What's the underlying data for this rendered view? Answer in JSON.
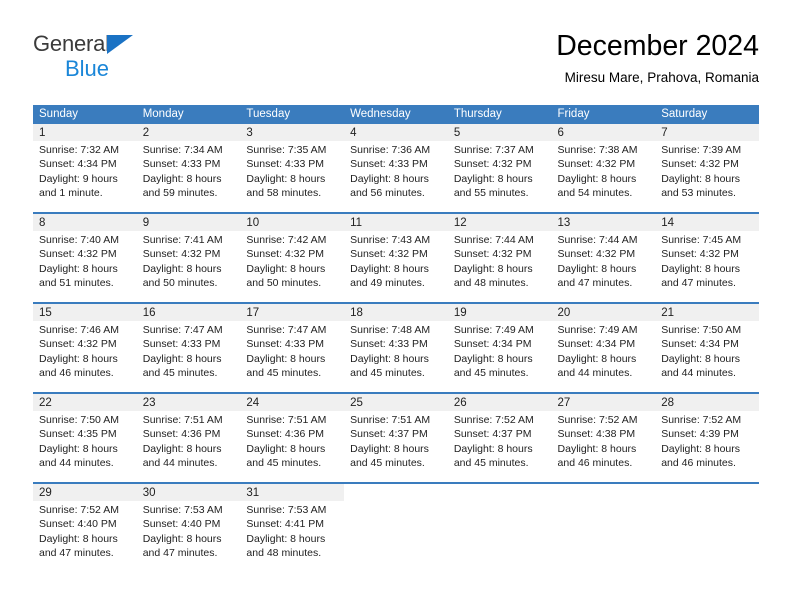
{
  "brand": {
    "line1": "General",
    "line2": "Blue",
    "triangle_color": "#1a72c4",
    "line2_color": "#1a86d8"
  },
  "header": {
    "month_title": "December 2024",
    "location": "Miresu Mare, Prahova, Romania"
  },
  "theme": {
    "header_bg": "#3a7cbe",
    "daynum_bg": "#f0f0f0",
    "text": "#222222"
  },
  "weekdays": [
    "Sunday",
    "Monday",
    "Tuesday",
    "Wednesday",
    "Thursday",
    "Friday",
    "Saturday"
  ],
  "weeks": [
    [
      {
        "day": "1",
        "sunrise": "Sunrise: 7:32 AM",
        "sunset": "Sunset: 4:34 PM",
        "daylight_1": "Daylight: 9 hours",
        "daylight_2": "and 1 minute."
      },
      {
        "day": "2",
        "sunrise": "Sunrise: 7:34 AM",
        "sunset": "Sunset: 4:33 PM",
        "daylight_1": "Daylight: 8 hours",
        "daylight_2": "and 59 minutes."
      },
      {
        "day": "3",
        "sunrise": "Sunrise: 7:35 AM",
        "sunset": "Sunset: 4:33 PM",
        "daylight_1": "Daylight: 8 hours",
        "daylight_2": "and 58 minutes."
      },
      {
        "day": "4",
        "sunrise": "Sunrise: 7:36 AM",
        "sunset": "Sunset: 4:33 PM",
        "daylight_1": "Daylight: 8 hours",
        "daylight_2": "and 56 minutes."
      },
      {
        "day": "5",
        "sunrise": "Sunrise: 7:37 AM",
        "sunset": "Sunset: 4:32 PM",
        "daylight_1": "Daylight: 8 hours",
        "daylight_2": "and 55 minutes."
      },
      {
        "day": "6",
        "sunrise": "Sunrise: 7:38 AM",
        "sunset": "Sunset: 4:32 PM",
        "daylight_1": "Daylight: 8 hours",
        "daylight_2": "and 54 minutes."
      },
      {
        "day": "7",
        "sunrise": "Sunrise: 7:39 AM",
        "sunset": "Sunset: 4:32 PM",
        "daylight_1": "Daylight: 8 hours",
        "daylight_2": "and 53 minutes."
      }
    ],
    [
      {
        "day": "8",
        "sunrise": "Sunrise: 7:40 AM",
        "sunset": "Sunset: 4:32 PM",
        "daylight_1": "Daylight: 8 hours",
        "daylight_2": "and 51 minutes."
      },
      {
        "day": "9",
        "sunrise": "Sunrise: 7:41 AM",
        "sunset": "Sunset: 4:32 PM",
        "daylight_1": "Daylight: 8 hours",
        "daylight_2": "and 50 minutes."
      },
      {
        "day": "10",
        "sunrise": "Sunrise: 7:42 AM",
        "sunset": "Sunset: 4:32 PM",
        "daylight_1": "Daylight: 8 hours",
        "daylight_2": "and 50 minutes."
      },
      {
        "day": "11",
        "sunrise": "Sunrise: 7:43 AM",
        "sunset": "Sunset: 4:32 PM",
        "daylight_1": "Daylight: 8 hours",
        "daylight_2": "and 49 minutes."
      },
      {
        "day": "12",
        "sunrise": "Sunrise: 7:44 AM",
        "sunset": "Sunset: 4:32 PM",
        "daylight_1": "Daylight: 8 hours",
        "daylight_2": "and 48 minutes."
      },
      {
        "day": "13",
        "sunrise": "Sunrise: 7:44 AM",
        "sunset": "Sunset: 4:32 PM",
        "daylight_1": "Daylight: 8 hours",
        "daylight_2": "and 47 minutes."
      },
      {
        "day": "14",
        "sunrise": "Sunrise: 7:45 AM",
        "sunset": "Sunset: 4:32 PM",
        "daylight_1": "Daylight: 8 hours",
        "daylight_2": "and 47 minutes."
      }
    ],
    [
      {
        "day": "15",
        "sunrise": "Sunrise: 7:46 AM",
        "sunset": "Sunset: 4:32 PM",
        "daylight_1": "Daylight: 8 hours",
        "daylight_2": "and 46 minutes."
      },
      {
        "day": "16",
        "sunrise": "Sunrise: 7:47 AM",
        "sunset": "Sunset: 4:33 PM",
        "daylight_1": "Daylight: 8 hours",
        "daylight_2": "and 45 minutes."
      },
      {
        "day": "17",
        "sunrise": "Sunrise: 7:47 AM",
        "sunset": "Sunset: 4:33 PM",
        "daylight_1": "Daylight: 8 hours",
        "daylight_2": "and 45 minutes."
      },
      {
        "day": "18",
        "sunrise": "Sunrise: 7:48 AM",
        "sunset": "Sunset: 4:33 PM",
        "daylight_1": "Daylight: 8 hours",
        "daylight_2": "and 45 minutes."
      },
      {
        "day": "19",
        "sunrise": "Sunrise: 7:49 AM",
        "sunset": "Sunset: 4:34 PM",
        "daylight_1": "Daylight: 8 hours",
        "daylight_2": "and 45 minutes."
      },
      {
        "day": "20",
        "sunrise": "Sunrise: 7:49 AM",
        "sunset": "Sunset: 4:34 PM",
        "daylight_1": "Daylight: 8 hours",
        "daylight_2": "and 44 minutes."
      },
      {
        "day": "21",
        "sunrise": "Sunrise: 7:50 AM",
        "sunset": "Sunset: 4:34 PM",
        "daylight_1": "Daylight: 8 hours",
        "daylight_2": "and 44 minutes."
      }
    ],
    [
      {
        "day": "22",
        "sunrise": "Sunrise: 7:50 AM",
        "sunset": "Sunset: 4:35 PM",
        "daylight_1": "Daylight: 8 hours",
        "daylight_2": "and 44 minutes."
      },
      {
        "day": "23",
        "sunrise": "Sunrise: 7:51 AM",
        "sunset": "Sunset: 4:36 PM",
        "daylight_1": "Daylight: 8 hours",
        "daylight_2": "and 44 minutes."
      },
      {
        "day": "24",
        "sunrise": "Sunrise: 7:51 AM",
        "sunset": "Sunset: 4:36 PM",
        "daylight_1": "Daylight: 8 hours",
        "daylight_2": "and 45 minutes."
      },
      {
        "day": "25",
        "sunrise": "Sunrise: 7:51 AM",
        "sunset": "Sunset: 4:37 PM",
        "daylight_1": "Daylight: 8 hours",
        "daylight_2": "and 45 minutes."
      },
      {
        "day": "26",
        "sunrise": "Sunrise: 7:52 AM",
        "sunset": "Sunset: 4:37 PM",
        "daylight_1": "Daylight: 8 hours",
        "daylight_2": "and 45 minutes."
      },
      {
        "day": "27",
        "sunrise": "Sunrise: 7:52 AM",
        "sunset": "Sunset: 4:38 PM",
        "daylight_1": "Daylight: 8 hours",
        "daylight_2": "and 46 minutes."
      },
      {
        "day": "28",
        "sunrise": "Sunrise: 7:52 AM",
        "sunset": "Sunset: 4:39 PM",
        "daylight_1": "Daylight: 8 hours",
        "daylight_2": "and 46 minutes."
      }
    ],
    [
      {
        "day": "29",
        "sunrise": "Sunrise: 7:52 AM",
        "sunset": "Sunset: 4:40 PM",
        "daylight_1": "Daylight: 8 hours",
        "daylight_2": "and 47 minutes."
      },
      {
        "day": "30",
        "sunrise": "Sunrise: 7:53 AM",
        "sunset": "Sunset: 4:40 PM",
        "daylight_1": "Daylight: 8 hours",
        "daylight_2": "and 47 minutes."
      },
      {
        "day": "31",
        "sunrise": "Sunrise: 7:53 AM",
        "sunset": "Sunset: 4:41 PM",
        "daylight_1": "Daylight: 8 hours",
        "daylight_2": "and 48 minutes."
      },
      {
        "day": "",
        "sunrise": "",
        "sunset": "",
        "daylight_1": "",
        "daylight_2": ""
      },
      {
        "day": "",
        "sunrise": "",
        "sunset": "",
        "daylight_1": "",
        "daylight_2": ""
      },
      {
        "day": "",
        "sunrise": "",
        "sunset": "",
        "daylight_1": "",
        "daylight_2": ""
      },
      {
        "day": "",
        "sunrise": "",
        "sunset": "",
        "daylight_1": "",
        "daylight_2": ""
      }
    ]
  ]
}
